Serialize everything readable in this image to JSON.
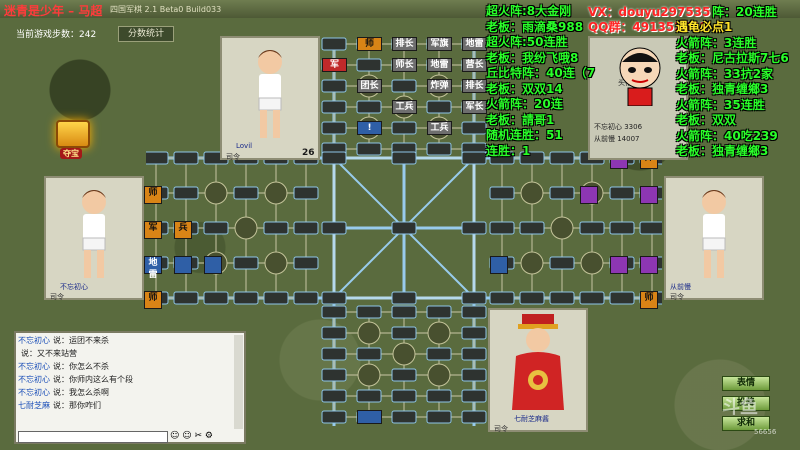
{
  "title": {
    "main": "迷青是少年 – 马超",
    "sub": "四国军棋 2.1 Beta0 Build033"
  },
  "steps": {
    "label": "当前游戏步数：",
    "value": "242"
  },
  "score_button": "分数统计",
  "treasure": {
    "label": "夺宝"
  },
  "avatars": {
    "top": {
      "name": "Lovil",
      "rank": "司令",
      "time": "26"
    },
    "left": {
      "name": "不忘初心",
      "rank": "司令"
    },
    "right": {
      "name": "从前慢",
      "rank": "司令"
    },
    "bottom": {
      "name": "七耐芝麻酱",
      "rank": "司令"
    }
  },
  "pieces": {
    "top": [
      {
        "label": "师",
        "color": "orange",
        "col": 1,
        "row": 0
      },
      {
        "label": "排长",
        "color": "gray",
        "col": 2,
        "row": 0
      },
      {
        "label": "军旗",
        "color": "gray",
        "col": 3,
        "row": 0
      },
      {
        "label": "地雷",
        "color": "gray",
        "col": 4,
        "row": 0
      },
      {
        "label": "军",
        "color": "red",
        "col": 0,
        "row": 1
      },
      {
        "label": "师长",
        "color": "gray",
        "col": 2,
        "row": 1
      },
      {
        "label": "地雷",
        "color": "gray",
        "col": 3,
        "row": 1
      },
      {
        "label": "营长",
        "color": "gray",
        "col": 4,
        "row": 1
      },
      {
        "label": "团长",
        "color": "gray",
        "col": 1,
        "row": 2
      },
      {
        "label": "炸弹",
        "color": "gray",
        "col": 3,
        "row": 2
      },
      {
        "label": "排长",
        "color": "gray",
        "col": 4,
        "row": 2
      },
      {
        "label": "工兵",
        "color": "gray",
        "col": 2,
        "row": 3
      },
      {
        "label": "军长",
        "color": "gray",
        "col": 4,
        "row": 3
      },
      {
        "label": "!",
        "color": "blue",
        "col": 1,
        "row": 4
      },
      {
        "label": "工兵",
        "color": "gray",
        "col": 3,
        "row": 4
      }
    ],
    "left": [
      {
        "label": "师",
        "color": "orange",
        "col": 0,
        "row": 1
      },
      {
        "label": "军",
        "color": "orange",
        "col": 0,
        "row": 2
      },
      {
        "label": "兵",
        "color": "orange",
        "col": 1,
        "row": 2
      },
      {
        "label": "地雷",
        "color": "blue",
        "col": 0,
        "row": 3
      },
      {
        "label": "",
        "color": "blue",
        "col": 1,
        "row": 3
      },
      {
        "label": "",
        "color": "blue",
        "col": 2,
        "row": 3
      },
      {
        "label": "师",
        "color": "orange",
        "col": 0,
        "row": 4
      }
    ],
    "right": [
      {
        "label": "",
        "color": "purple",
        "col": 4,
        "row": 0
      },
      {
        "label": "师",
        "color": "orange",
        "col": 5,
        "row": 0
      },
      {
        "label": "",
        "color": "purple",
        "col": 3,
        "row": 1
      },
      {
        "label": "",
        "color": "purple",
        "col": 5,
        "row": 1
      },
      {
        "label": "",
        "color": "blue",
        "col": 0,
        "row": 3
      },
      {
        "label": "",
        "color": "purple",
        "col": 4,
        "row": 3
      },
      {
        "label": "",
        "color": "purple",
        "col": 5,
        "row": 3
      },
      {
        "label": "师",
        "color": "orange",
        "col": 5,
        "row": 4
      }
    ],
    "bottom": [
      {
        "label": "",
        "color": "blue",
        "col": 1,
        "row": 5
      }
    ]
  },
  "chat": {
    "lines": [
      {
        "user": "不忘初心",
        "text": "说：运团不来杀"
      },
      {
        "user": "",
        "text": "说：又不来站营"
      },
      {
        "user": "不忘初心",
        "text": "说：你怎么不杀"
      },
      {
        "user": "不忘初心",
        "text": "说：你师内这么有个段"
      },
      {
        "user": "不忘初心",
        "text": "说：我怎么杀啊"
      },
      {
        "user": "七耐芝麻",
        "text": "说：那你咋们"
      }
    ],
    "tools": "☺ ☺ ✂ ⚙"
  },
  "overlay": {
    "left_column": [
      {
        "text": "超火阵:8大金刚",
        "style": "green"
      },
      {
        "text": "老板：雨滴桑988",
        "style": "green"
      },
      {
        "text": "超火阵:50连胜",
        "style": "green"
      },
      {
        "text": "老板：我纷飞哦8",
        "style": "green"
      },
      {
        "text": "丘比特阵：40连（7",
        "style": "green"
      },
      {
        "text": "老板：双双14",
        "style": "green"
      },
      {
        "text": "火箭阵：20连",
        "style": "green"
      },
      {
        "text": "老板：請哥1",
        "style": "green"
      },
      {
        "text": "随机连胜：51",
        "style": "green"
      },
      {
        "text": "连胜：1",
        "style": "green"
      }
    ],
    "contact_vx": "VX：douyu297535",
    "contact_qq": "QQ群：491352658",
    "right_column": [
      {
        "text": "阵：20连胜",
        "style": "green"
      },
      {
        "text": "遇龟必点1",
        "style": "yellow"
      },
      {
        "text": "火箭阵：3连胜",
        "style": "green"
      },
      {
        "text": "老板：尼古拉斯7七6",
        "style": "green"
      },
      {
        "text": "火箭阵：33抗2家",
        "style": "green"
      },
      {
        "text": "老板：独青缠鄉3",
        "style": "green"
      },
      {
        "text": "火箭阵：35连胜",
        "style": "green"
      },
      {
        "text": "老板：双双",
        "style": "green"
      },
      {
        "text": "火箭阵：40吃239",
        "style": "green"
      },
      {
        "text": "老板：独青缠鄉3",
        "style": "green"
      }
    ]
  },
  "right_panel": {
    "header": "头衔  积分",
    "rows": [
      {
        "name": "不忘初心",
        "score": "3306"
      },
      {
        "name": "从前慢",
        "score": "14007"
      }
    ]
  },
  "buttons": {
    "emote": "表情",
    "withdraw": "投降",
    "surrender": "求和"
  },
  "watermark": {
    "logo": "斗鱼",
    "id": "56656"
  },
  "colors": {
    "gray": "#6e6e6e",
    "orange": "#d98416",
    "blue": "#2f5fa6",
    "purple": "#8d36b3",
    "red": "#c02a2a"
  }
}
